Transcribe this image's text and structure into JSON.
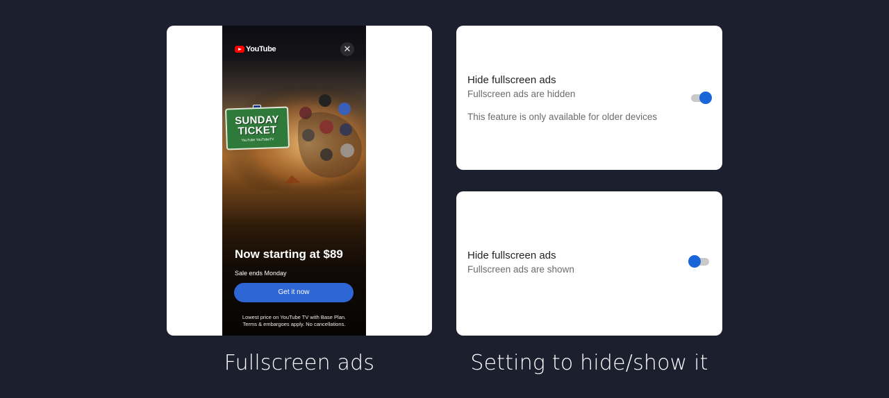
{
  "colors": {
    "background": "#1c1f2e",
    "card": "#ffffff",
    "accent": "#1a66d9",
    "cta": "#2f66d6"
  },
  "ad": {
    "brand": "YouTube",
    "close_icon": "close-icon",
    "ticket_line1": "SUNDAY",
    "ticket_line2": "TICKET",
    "ticket_sub": "YouTube  YouTubeTV",
    "headline": "Now starting at $89",
    "subline": "Sale ends Monday",
    "cta_label": "Get it now",
    "disclaimer_line1": "Lowest price on YouTube TV with Base Plan.",
    "disclaimer_line2": "Terms & embargoes apply. No cancellations."
  },
  "settings": [
    {
      "title": "Hide fullscreen ads",
      "subtitle": "Fullscreen ads are hidden",
      "note": "This feature is only available for older devices",
      "toggle_on": true
    },
    {
      "title": "Hide fullscreen ads",
      "subtitle": "Fullscreen ads are shown",
      "toggle_on": false
    }
  ],
  "captions": {
    "left": "Fullscreen ads",
    "right": "Setting to hide/show it"
  }
}
